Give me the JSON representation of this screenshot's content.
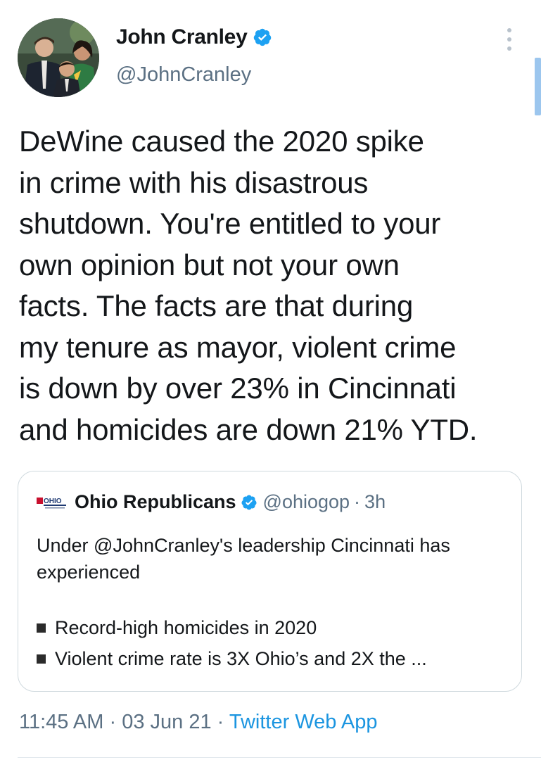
{
  "author": {
    "name": "John Cranley",
    "handle": "@JohnCranley",
    "verified": true,
    "avatar_icon": "family-photo-avatar"
  },
  "tweet": {
    "text": "DeWine caused the 2020 spike\nin crime with his disastrous\nshutdown. You're entitled to your\nown opinion but not your own\nfacts. The facts are that during\nmy tenure as mayor, violent crime\nis down by over 23% in Cincinnati\nand homicides are down 21% YTD."
  },
  "quote_tweet": {
    "logo_text": "OHIO",
    "name": "Ohio Republicans",
    "verified": true,
    "handle": "@ohiogop",
    "separator": "·",
    "time": "3h",
    "text": "Under @JohnCranley's leadership Cincinnati has experienced",
    "bullets": [
      "Record-high homicides in 2020",
      "Violent crime rate is 3X Ohio’s and 2X the ..."
    ]
  },
  "meta": {
    "time": "11:45 AM",
    "date": "03 Jun 21",
    "source": "Twitter Web App",
    "separator": "·"
  },
  "colors": {
    "text": "#14171a",
    "secondary": "#5b7083",
    "accent": "#1b95e0",
    "verified": "#1da1f2",
    "border": "#cfd9de"
  }
}
